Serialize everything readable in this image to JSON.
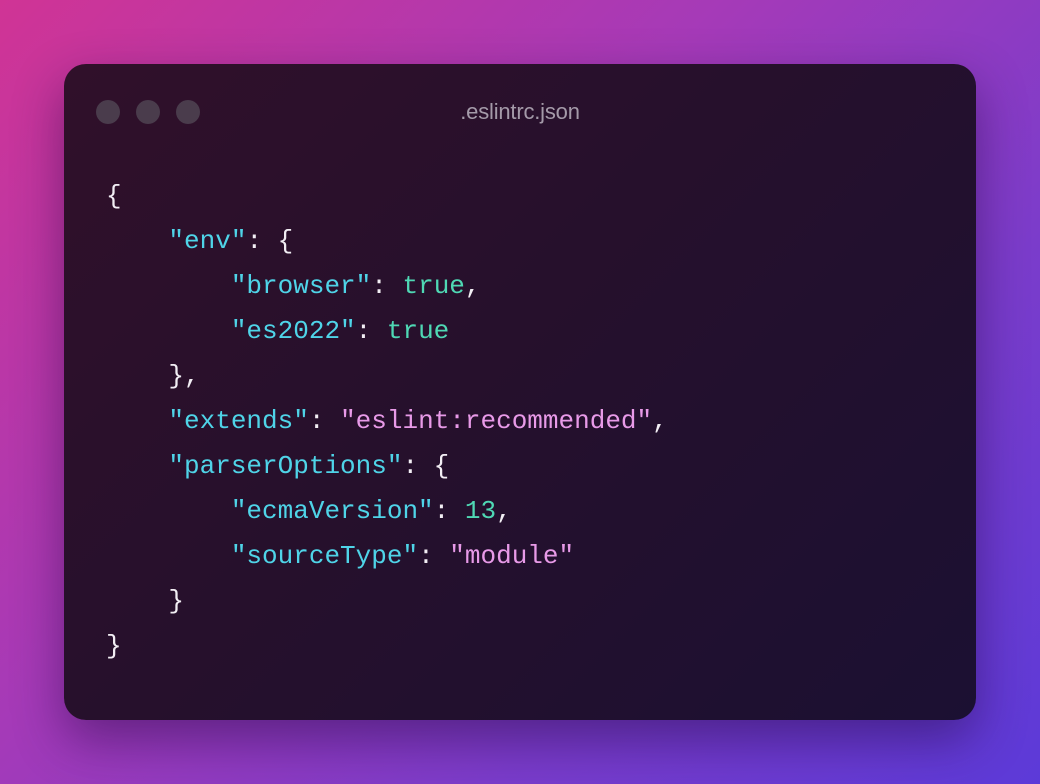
{
  "window": {
    "title": ".eslintrc.json",
    "traffic_lights": [
      "close",
      "minimize",
      "zoom"
    ]
  },
  "code": {
    "open_brace": "{",
    "close_brace": "}",
    "env_key": "\"env\"",
    "browser_key": "\"browser\"",
    "browser_value": "true",
    "es2022_key": "\"es2022\"",
    "es2022_value": "true",
    "extends_key": "\"extends\"",
    "extends_value": "\"eslint:recommended\"",
    "parserOptions_key": "\"parserOptions\"",
    "ecmaVersion_key": "\"ecmaVersion\"",
    "ecmaVersion_value": "13",
    "sourceType_key": "\"sourceType\"",
    "sourceType_value": "\"module\""
  },
  "colors": {
    "key": "#4fd4e8",
    "boolean_number": "#4fd8b4",
    "string": "#e89ae8",
    "punctuation": "#f2eef4"
  }
}
